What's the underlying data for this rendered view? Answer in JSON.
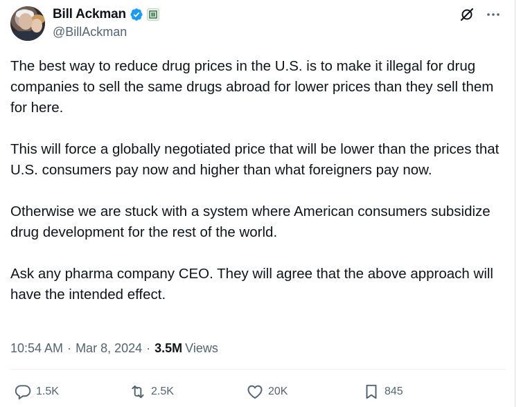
{
  "author": {
    "display_name": "Bill Ackman",
    "handle": "@BillAckman",
    "verified": true,
    "avatar_icon": "avatar-photo"
  },
  "tweet": {
    "paragraphs": [
      "The best way to reduce drug prices in the U.S. is to make it illegal for drug companies to sell the same drugs abroad for lower prices than they sell them for here.",
      "This will force a globally negotiated price that will be lower than the prices that U.S. consumers pay now and higher than what foreigners pay now.",
      "Otherwise we are stuck with a system where American consumers subsidize drug development for the rest of the world.",
      "Ask any pharma company CEO. They will agree that the above approach will have the intended effect."
    ],
    "time": "10:54 AM",
    "date": "Mar 8, 2024",
    "separator": "·",
    "views_count": "3.5M",
    "views_label": "Views"
  },
  "actions": {
    "replies": "1.5K",
    "reposts": "2.5K",
    "likes": "20K",
    "bookmarks": "845"
  },
  "colors": {
    "text": "#0f1419",
    "muted": "#536471",
    "verified_blue": "#1d9bf0"
  }
}
